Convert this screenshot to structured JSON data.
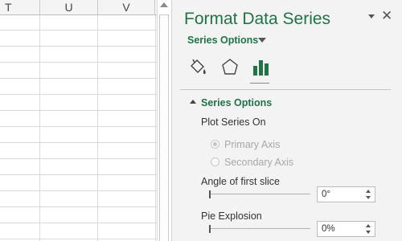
{
  "sheet": {
    "columns": [
      "T",
      "U",
      "V"
    ]
  },
  "pane": {
    "title": "Format Data Series",
    "menu_label": "Series Options",
    "section_title": "Series Options",
    "plot_series_on_label": "Plot Series On",
    "radio": {
      "primary": "Primary Axis",
      "secondary": "Secondary Axis",
      "selected": "primary",
      "enabled": false
    },
    "angle_label": "Angle of first slice",
    "angle_value": "0°",
    "angle_fraction": 0,
    "explosion_label": "Pie Explosion",
    "explosion_value": "0%",
    "explosion_fraction": 0,
    "icons": [
      "fill-line-icon",
      "effects-icon",
      "series-options-icon"
    ],
    "active_tab": "series-options",
    "colors": {
      "accent": "#217346",
      "disabled_text": "#a8a8a8",
      "pane_background": "#f3f3f3"
    }
  }
}
